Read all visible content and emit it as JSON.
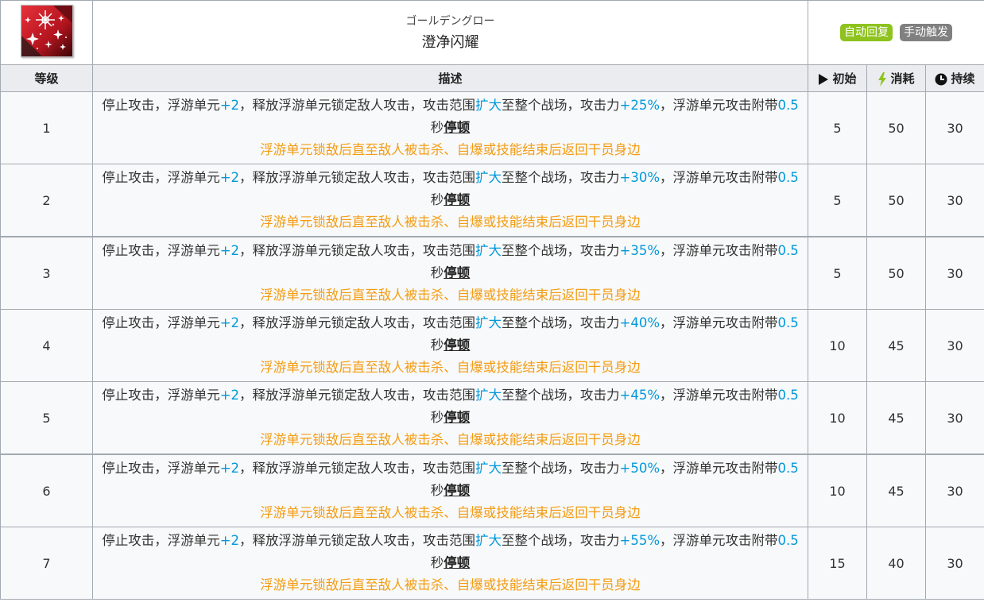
{
  "skill": {
    "name_jp": "ゴールデングロー",
    "name_cn": "澄净闪耀",
    "icon": "sparkle-skill-icon",
    "badges": [
      {
        "label": "自动回复",
        "color": "#8ec31f"
      },
      {
        "label": "手动触发",
        "color": "#808080"
      }
    ]
  },
  "columns": {
    "level": "等级",
    "desc": "描述",
    "init": "初始",
    "cost": "消耗",
    "duration": "持续"
  },
  "icons": {
    "init": "play-icon",
    "cost": "lightning-icon",
    "duration": "clock-icon"
  },
  "colors": {
    "highlight": "#0098dc",
    "note": "#f39c12",
    "header_bg": "#eaecf0",
    "row_bg": "#f8f9fa"
  },
  "levels": [
    {
      "level": "1",
      "atk": "+25%",
      "init": "5",
      "cost": "50",
      "duration": "30"
    },
    {
      "level": "2",
      "atk": "+30%",
      "init": "5",
      "cost": "50",
      "duration": "30"
    },
    {
      "level": "3",
      "atk": "+35%",
      "init": "5",
      "cost": "50",
      "duration": "30"
    },
    {
      "level": "4",
      "atk": "+40%",
      "init": "10",
      "cost": "45",
      "duration": "30"
    },
    {
      "level": "5",
      "atk": "+45%",
      "init": "10",
      "cost": "45",
      "duration": "30"
    },
    {
      "level": "6",
      "atk": "+50%",
      "init": "10",
      "cost": "45",
      "duration": "30"
    },
    {
      "level": "7",
      "atk": "+55%",
      "init": "15",
      "cost": "40",
      "duration": "30"
    }
  ],
  "desc_parts": {
    "p1": "停止攻击，浮游单元",
    "units": "+2",
    "p2": "，释放浮游单元锁定敌人攻击，攻击范围",
    "expand": "扩大",
    "p3": "至整个战场，攻击力",
    "p4": "，浮游单元攻击附带",
    "seconds": "0.5",
    "p5": "秒",
    "stun": "停顿",
    "note": "浮游单元锁敌后直至敌人被击杀、自爆或技能结束后返回干员身边"
  }
}
